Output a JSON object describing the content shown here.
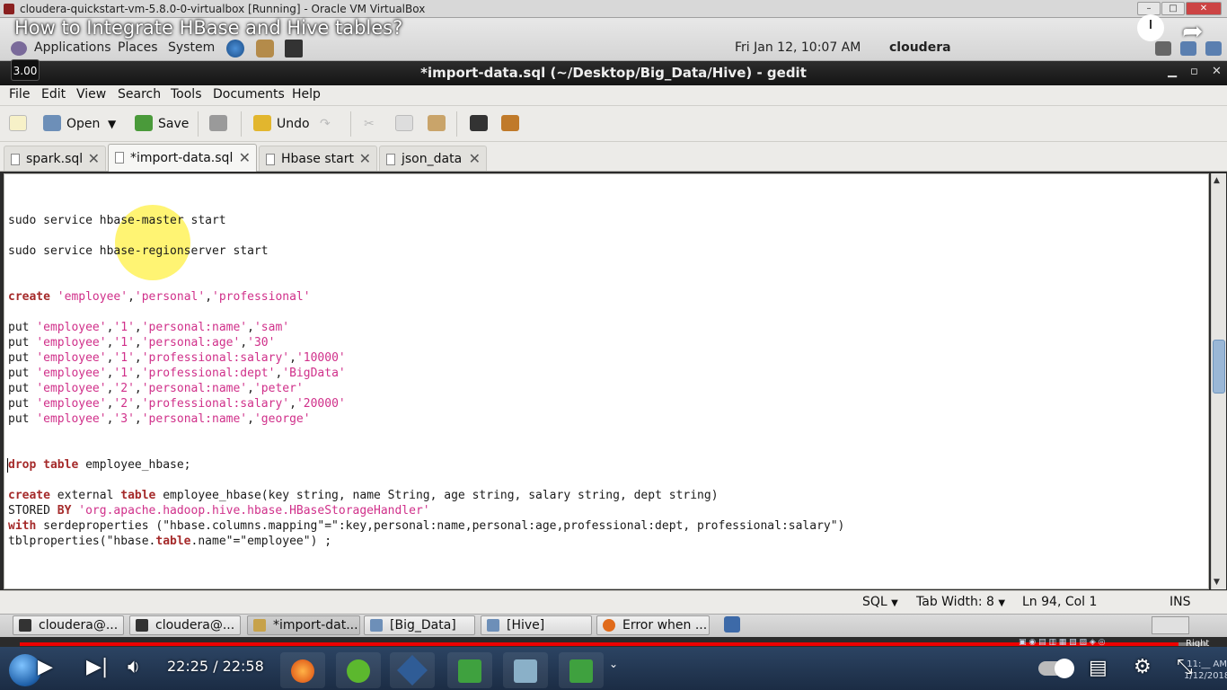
{
  "vbox": {
    "title": "cloudera-quickstart-vm-5.8.0-0-virtualbox [Running] - Oracle VM VirtualBox"
  },
  "video": {
    "title": "How to Integrate HBase and Hive tables?",
    "speed": "3.00",
    "time": "22:25 / 22:58",
    "progress": 0.976
  },
  "panel": {
    "menus": [
      "Applications",
      "Places",
      "System"
    ],
    "clock": "Fri Jan 12, 10:07 AM",
    "user": "cloudera"
  },
  "window": {
    "title": "*import-data.sql (~/Desktop/Big_Data/Hive) - gedit"
  },
  "menubar": [
    "File",
    "Edit",
    "View",
    "Search",
    "Tools",
    "Documents",
    "Help"
  ],
  "toolbar": {
    "open": "Open",
    "save": "Save",
    "undo": "Undo"
  },
  "tabs": [
    {
      "label": "spark.sql",
      "active": false
    },
    {
      "label": "*import-data.sql",
      "active": true
    },
    {
      "label": "Hbase start",
      "active": false
    },
    {
      "label": "json_data",
      "active": false
    }
  ],
  "code": {
    "line1": "sudo service hbase-master start",
    "line2": "sudo service hbase-regionserver start",
    "create_kw": "create",
    "create_args": [
      "'employee'",
      "'personal'",
      "'professional'"
    ],
    "puts": [
      [
        "'employee'",
        "'1'",
        "'personal:name'",
        "'sam'"
      ],
      [
        "'employee'",
        "'1'",
        "'personal:age'",
        "'30'"
      ],
      [
        "'employee'",
        "'1'",
        "'professional:salary'",
        "'10000'"
      ],
      [
        "'employee'",
        "'1'",
        "'professional:dept'",
        "'BigData'"
      ],
      [
        "'employee'",
        "'2'",
        "'personal:name'",
        "'peter'"
      ],
      [
        "'employee'",
        "'2'",
        "'professional:salary'",
        "'20000'"
      ],
      [
        "'employee'",
        "'3'",
        "'personal:name'",
        "'george'"
      ]
    ],
    "put_kw": "put",
    "drop_kw": "drop",
    "table_kw": "table",
    "drop_rest": " employee_hbase;",
    "ext_kw": "create",
    "ext_mid": " external ",
    "ext_rest": " employee_hbase(key string, name String, age string, salary string, dept string)",
    "stored": "STORED ",
    "by_kw": "BY",
    "handler": "'org.apache.hadoop.hive.hbase.HBaseStorageHandler'",
    "with_kw": "with",
    "serde": " serdeproperties (\"hbase.columns.mapping\"=\":key,personal:name,personal:age,professional:dept, professional:salary\")",
    "tbl_a": "tblproperties(\"hbase.",
    "tbl_b": "table",
    "tbl_c": ".name\"=\"employee\") ;"
  },
  "status": {
    "language": "SQL",
    "tab_width": "Tab Width:  8",
    "position": "Ln 94, Col 1",
    "mode": "INS"
  },
  "taskbar_items": [
    "cloudera@...",
    "cloudera@...",
    "*import-dat...",
    "[Big_Data]",
    "[Hive]",
    "Error when ..."
  ],
  "tray": {
    "time": "11:__ AM",
    "date": "1/12/2018",
    "right_ctrl": "Right Ctrl"
  }
}
